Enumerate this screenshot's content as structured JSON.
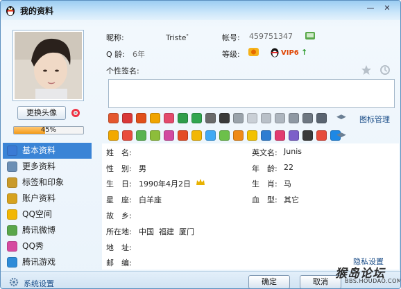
{
  "window": {
    "title": "我的资料",
    "minimize_glyph": "—",
    "close_glyph": "✕"
  },
  "left": {
    "change_avatar": "更换头像",
    "completion_percent": 45,
    "completion_text": "45%",
    "nav": [
      {
        "label": "基本资料",
        "icon": "profile-card-icon",
        "active": true
      },
      {
        "label": "更多资料",
        "icon": "document-icon",
        "active": false
      },
      {
        "label": "标签和印象",
        "icon": "tag-icon",
        "active": false
      },
      {
        "label": "账户资料",
        "icon": "account-icon",
        "active": false
      },
      {
        "label": "QQ空间",
        "icon": "star-icon",
        "active": false
      },
      {
        "label": "腾讯微博",
        "icon": "weibo-icon",
        "active": false
      },
      {
        "label": "QQ秀",
        "icon": "qqshow-icon",
        "active": false
      },
      {
        "label": "腾讯游戏",
        "icon": "game-icon",
        "active": false
      }
    ],
    "system_settings": "系统设置"
  },
  "info": {
    "nickname_label": "昵称:",
    "nickname": "Triste゜",
    "account_label": "帐号:",
    "account": "459751347",
    "qage_label": "Q 龄:",
    "qage": "6年",
    "level_label": "等级:",
    "vip": "VIP6",
    "signature_label": "个性签名:"
  },
  "icon_rows": {
    "row1_count": 16,
    "row2_count": 17,
    "icon_manage": "图标管理"
  },
  "fields": {
    "name_label": "姓　名:",
    "name_value": "",
    "english_name_label": "英文名:",
    "english_name_value": "Junis",
    "gender_label": "性　别:",
    "gender_value": "男",
    "age_label": "年　龄:",
    "age_value": "22",
    "birthday_label": "生　日:",
    "birthday_value": "1990年4月2日",
    "zodiac_label": "生　肖:",
    "zodiac_value": "马",
    "constellation_label": "星　座:",
    "constellation_value": "白羊座",
    "blood_label": "血　型:",
    "blood_value": "其它",
    "hometown_label": "故　乡:",
    "hometown_value": "",
    "location_label": "所在地:",
    "location_value": "中国  福建  厦门",
    "address_label": "地　址:",
    "address_value": "",
    "postcode_label": "邮　编:",
    "postcode_value": ""
  },
  "footer": {
    "privacy": "隐私设置",
    "ok": "确定",
    "cancel": "取消",
    "watermark_main": "猴岛论坛",
    "watermark_sub": "BBS.HOUDAO.COM"
  },
  "colors": {
    "accent": "#3a84d6",
    "progress": "#f49a16",
    "link": "#1d4f89"
  }
}
